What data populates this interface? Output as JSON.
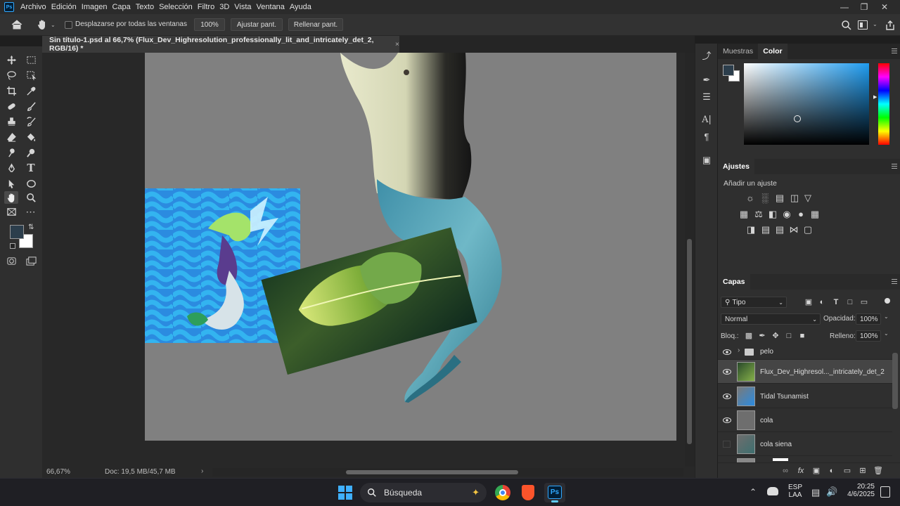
{
  "menubar": {
    "app_logo": "Ps",
    "items": [
      "Archivo",
      "Edición",
      "Imagen",
      "Capa",
      "Texto",
      "Selección",
      "Filtro",
      "3D",
      "Vista",
      "Ventana",
      "Ayuda"
    ]
  },
  "options": {
    "scroll_all_label": "Desplazarse por todas las ventanas",
    "zoom_value": "100%",
    "fit_screen": "Ajustar pant.",
    "fill_screen": "Rellenar pant."
  },
  "document": {
    "tab_title": "Sin título-1.psd al 66,7% (Flux_Dev_Highresolution_professionally_lit_and_intricately_det_2, RGB/16) *",
    "close": "×"
  },
  "status": {
    "zoom": "66,67%",
    "doc_size": "Doc: 19,5 MB/45,7 MB",
    "arrow": "›"
  },
  "panels": {
    "swatches_tab": "Muestras",
    "color_tab": "Color",
    "adjustments_title": "Ajustes",
    "add_adjustment": "Añadir un ajuste",
    "layers_title": "Capas",
    "filter_kind": "Tipo",
    "blend_mode": "Normal",
    "opacity_label": "Opacidad:",
    "opacity_value": "100%",
    "lock_label": "Bloq.:",
    "fill_label": "Relleno:",
    "fill_value": "100%",
    "layers": [
      {
        "name": "pelo",
        "visible": true,
        "group": true
      },
      {
        "name": "Flux_Dev_Highresol..._intricately_det_2",
        "visible": true,
        "selected": true
      },
      {
        "name": "Tidal Tsunamist",
        "visible": true
      },
      {
        "name": "cola",
        "visible": true
      },
      {
        "name": "cola siena",
        "visible": false
      }
    ]
  },
  "colors": {
    "foreground": "#2c3e4c",
    "background": "#ffffff",
    "accent": "#31a8ff"
  },
  "taskbar": {
    "search_placeholder": "Búsqueda",
    "lang_top": "ESP",
    "lang_bottom": "LAA",
    "time": "20:25",
    "date": "4/6/2025"
  }
}
